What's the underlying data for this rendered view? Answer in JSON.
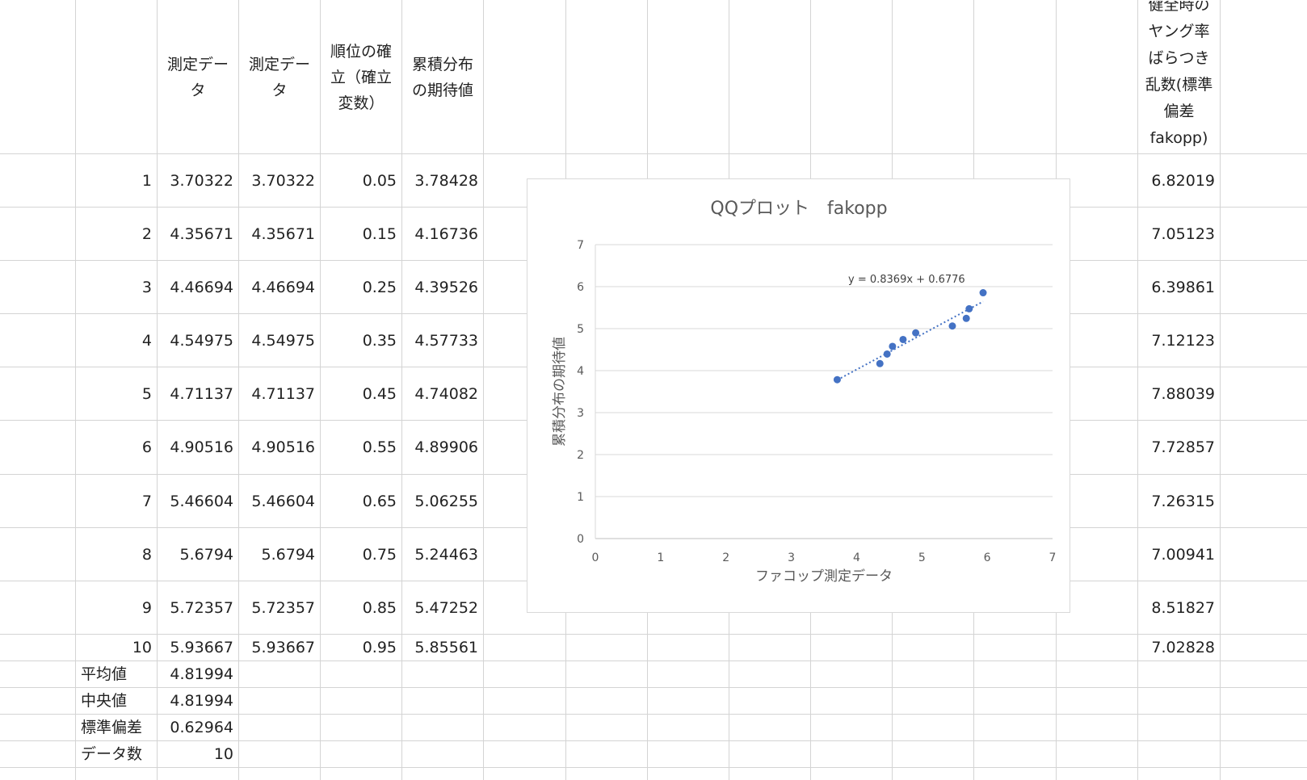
{
  "headers": {
    "col_c": "測定データ",
    "col_d": "測定データ",
    "col_e": "順位の確立（確立変数）",
    "col_f": "累積分布の期待値",
    "col_o": "健全時のヤング率ばらつき乱数(標準偏差fakopp)"
  },
  "rows": [
    {
      "n": "1",
      "c": "3.70322",
      "d": "3.70322",
      "e": "0.05",
      "f": "3.78428",
      "o": "6.82019"
    },
    {
      "n": "2",
      "c": "4.35671",
      "d": "4.35671",
      "e": "0.15",
      "f": "4.16736",
      "o": "7.05123"
    },
    {
      "n": "3",
      "c": "4.46694",
      "d": "4.46694",
      "e": "0.25",
      "f": "4.39526",
      "o": "6.39861"
    },
    {
      "n": "4",
      "c": "4.54975",
      "d": "4.54975",
      "e": "0.35",
      "f": "4.57733",
      "o": "7.12123"
    },
    {
      "n": "5",
      "c": "4.71137",
      "d": "4.71137",
      "e": "0.45",
      "f": "4.74082",
      "o": "7.88039"
    },
    {
      "n": "6",
      "c": "4.90516",
      "d": "4.90516",
      "e": "0.55",
      "f": "4.89906",
      "o": "7.72857"
    },
    {
      "n": "7",
      "c": "5.46604",
      "d": "5.46604",
      "e": "0.65",
      "f": "5.06255",
      "o": "7.26315"
    },
    {
      "n": "8",
      "c": "5.6794",
      "d": "5.6794",
      "e": "0.75",
      "f": "5.24463",
      "o": "7.00941"
    },
    {
      "n": "9",
      "c": "5.72357",
      "d": "5.72357",
      "e": "0.85",
      "f": "5.47252",
      "o": "8.51827"
    },
    {
      "n": "10",
      "c": "5.93667",
      "d": "5.93667",
      "e": "0.95",
      "f": "5.85561",
      "o": "7.02828"
    }
  ],
  "stats": [
    {
      "label": "平均値",
      "value": "4.81994"
    },
    {
      "label": "中央値",
      "value": "4.81994"
    },
    {
      "label": "標準偏差",
      "value": "0.62964"
    },
    {
      "label": "データ数",
      "value": "10"
    }
  ],
  "chart_data": {
    "type": "scatter",
    "title": "QQプロット　fakopp",
    "xlabel": "ファコップ測定データ",
    "ylabel": "累積分布の期待値",
    "xlim": [
      0,
      7
    ],
    "ylim": [
      0,
      7
    ],
    "xticks": [
      "0",
      "1",
      "2",
      "3",
      "4",
      "5",
      "6",
      "7"
    ],
    "yticks": [
      "0",
      "1",
      "2",
      "3",
      "4",
      "5",
      "6",
      "7"
    ],
    "grid": true,
    "marker_color": "#4472c4",
    "points": [
      {
        "x": 3.70322,
        "y": 3.78428
      },
      {
        "x": 4.35671,
        "y": 4.16736
      },
      {
        "x": 4.46694,
        "y": 4.39526
      },
      {
        "x": 4.54975,
        "y": 4.57733
      },
      {
        "x": 4.71137,
        "y": 4.74082
      },
      {
        "x": 4.90516,
        "y": 4.89906
      },
      {
        "x": 5.46604,
        "y": 5.06255
      },
      {
        "x": 5.6794,
        "y": 5.24463
      },
      {
        "x": 5.72357,
        "y": 5.47252
      },
      {
        "x": 5.93667,
        "y": 5.85561
      }
    ],
    "trendline": {
      "slope": 0.8369,
      "intercept": 0.6776,
      "equation": "y = 0.8369x + 0.6776"
    }
  }
}
